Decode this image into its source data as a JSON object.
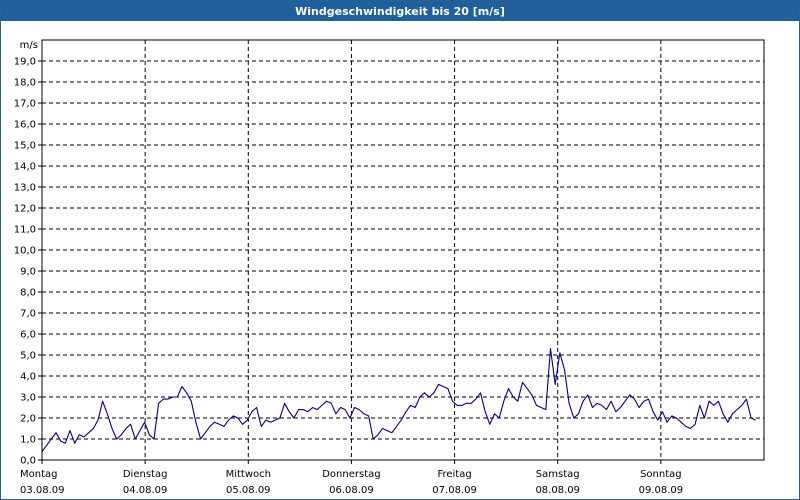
{
  "window": {
    "title": "Windgeschwindigkeit bis 20 [m/s]"
  },
  "chart_data": {
    "type": "line",
    "title": "Windgeschwindigkeit bis 20 [m/s]",
    "ylabel": "m/s",
    "ylim": [
      0,
      20
    ],
    "yticks": [
      "0,0",
      "1,0",
      "2,0",
      "3,0",
      "4,0",
      "5,0",
      "6,0",
      "7,0",
      "8,0",
      "9,0",
      "10,0",
      "11,0",
      "12,0",
      "13,0",
      "14,0",
      "15,0",
      "16,0",
      "17,0",
      "18,0",
      "19,0"
    ],
    "xlim": [
      0,
      7
    ],
    "x_ticks": [
      {
        "x": 0,
        "day": "Montag",
        "date": "03.08.09"
      },
      {
        "x": 1,
        "day": "Dienstag",
        "date": "04.08.09"
      },
      {
        "x": 2,
        "day": "Mittwoch",
        "date": "05.08.09"
      },
      {
        "x": 3,
        "day": "Donnerstag",
        "date": "06.08.09"
      },
      {
        "x": 4,
        "day": "Freitag",
        "date": "07.08.09"
      },
      {
        "x": 5,
        "day": "Samstag",
        "date": "08.08.09"
      },
      {
        "x": 6,
        "day": "Sonntag",
        "date": "09.08.09"
      }
    ],
    "grid": true,
    "line_color": "#00008b",
    "series": [
      {
        "name": "",
        "values": [
          0.4,
          0.7,
          1.0,
          1.3,
          0.9,
          0.8,
          1.4,
          0.8,
          1.2,
          1.1,
          1.3,
          1.5,
          1.9,
          2.8,
          2.2,
          1.5,
          1.0,
          1.2,
          1.5,
          1.7,
          1.0,
          1.4,
          1.8,
          1.2,
          1.0,
          2.7,
          2.9,
          2.9,
          3.0,
          3.0,
          3.5,
          3.2,
          2.8,
          1.8,
          1.0,
          1.3,
          1.6,
          1.8,
          1.7,
          1.6,
          1.9,
          2.1,
          2.0,
          1.7,
          1.9,
          2.3,
          2.5,
          1.6,
          1.9,
          1.8,
          1.9,
          2.0,
          2.7,
          2.3,
          2.0,
          2.4,
          2.4,
          2.3,
          2.5,
          2.4,
          2.6,
          2.8,
          2.7,
          2.2,
          2.5,
          2.4,
          2.0,
          2.5,
          2.4,
          2.2,
          2.1,
          1.0,
          1.2,
          1.5,
          1.4,
          1.3,
          1.6,
          1.9,
          2.3,
          2.6,
          2.5,
          3.0,
          3.2,
          3.0,
          3.2,
          3.6,
          3.5,
          3.4,
          2.8,
          2.6,
          2.6,
          2.7,
          2.7,
          2.9,
          3.2,
          2.3,
          1.7,
          2.2,
          2.0,
          2.8,
          3.4,
          3.0,
          2.8,
          3.7,
          3.4,
          3.1,
          2.6,
          2.5,
          2.4,
          5.3,
          3.6,
          5.1,
          4.3,
          2.7,
          2.0,
          2.2,
          2.8,
          3.1,
          2.5,
          2.7,
          2.6,
          2.4,
          2.8,
          2.3,
          2.5,
          2.8,
          3.1,
          2.9,
          2.5,
          2.8,
          2.9,
          2.3,
          1.9,
          2.3,
          1.8,
          2.1,
          2.0,
          1.8,
          1.6,
          1.5,
          1.7,
          2.6,
          2.0,
          2.8,
          2.6,
          2.8,
          2.2,
          1.8,
          2.2,
          2.4,
          2.6,
          2.9,
          2.0,
          1.9
        ]
      }
    ]
  }
}
